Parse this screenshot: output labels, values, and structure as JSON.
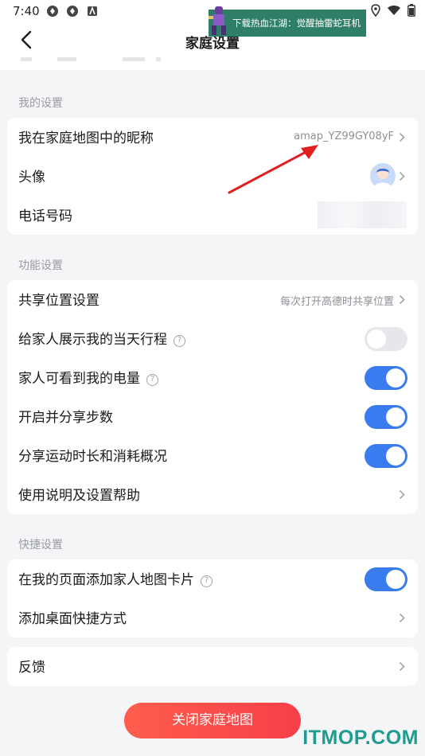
{
  "status_bar": {
    "time": "7:40",
    "icons": [
      "notification-icon",
      "notification-icon",
      "app-icon",
      "location-icon",
      "wifi-icon",
      "battery-icon"
    ]
  },
  "banner": {
    "text": "下载热血江湖：觉醒抽雷蛇耳机"
  },
  "nav": {
    "title": "家庭设置",
    "back_icon": "back-arrow-icon"
  },
  "sections": {
    "my_settings": {
      "label": "我的设置",
      "nickname": {
        "label": "我在家庭地图中的昵称",
        "value": "amap_YZ99GY08yF"
      },
      "avatar": {
        "label": "头像"
      },
      "phone": {
        "label": "电话号码"
      }
    },
    "feature_settings": {
      "label": "功能设置",
      "share_location": {
        "label": "共享位置设置",
        "value": "每次打开高德时共享位置"
      },
      "show_trip": {
        "label": "给家人展示我的当天行程",
        "enabled": false
      },
      "battery": {
        "label": "家人可看到我的电量",
        "enabled": true
      },
      "steps": {
        "label": "开启并分享步数",
        "enabled": true
      },
      "sports": {
        "label": "分享运动时长和消耗概况",
        "enabled": true
      },
      "help": {
        "label": "使用说明及设置帮助"
      }
    },
    "shortcut_settings": {
      "label": "快捷设置",
      "add_card": {
        "label": "在我的页面添加家人地图卡片",
        "enabled": true
      },
      "desktop_shortcut": {
        "label": "添加桌面快捷方式"
      }
    },
    "feedback": {
      "label": "反馈"
    }
  },
  "buttons": {
    "close_family_map": "关闭家庭地图"
  },
  "help_mark": "?",
  "watermark": "ITMOP.COM",
  "colors": {
    "accent": "#3a7cf0",
    "danger": "#f63f47",
    "annotation_arrow": "#e02020",
    "watermark": "#1f9b8f"
  }
}
